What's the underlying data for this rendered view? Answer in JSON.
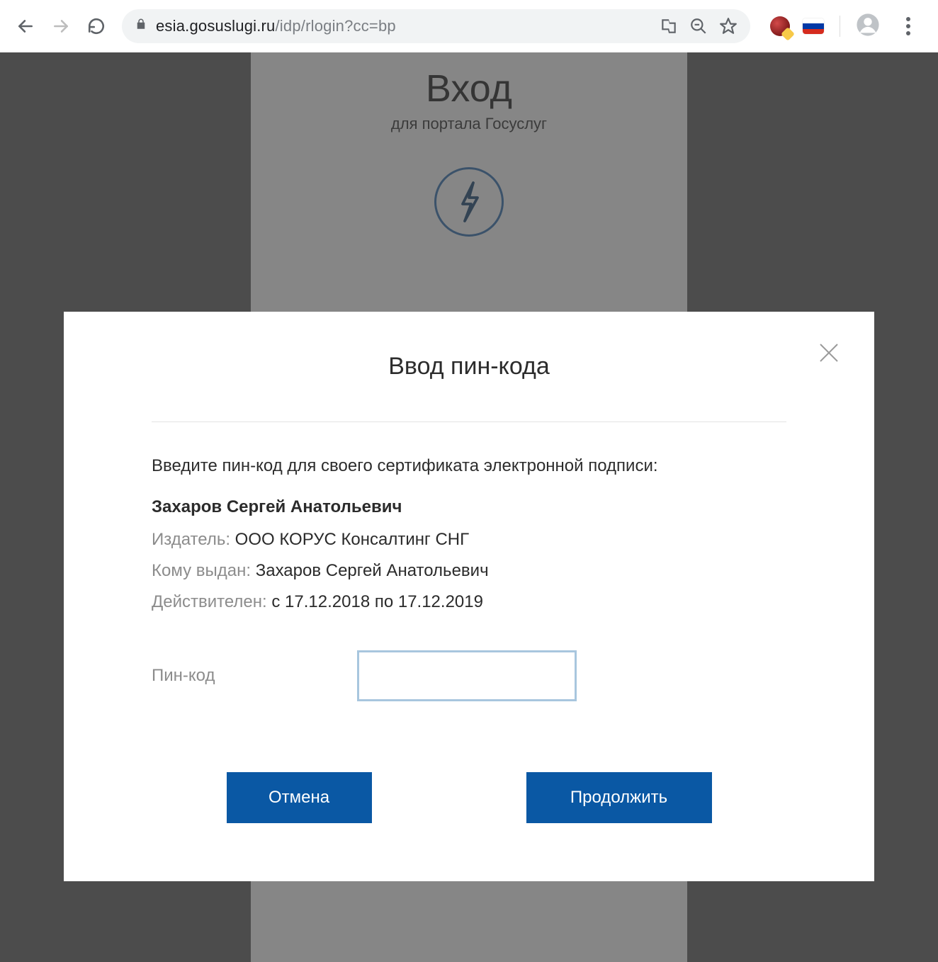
{
  "browser": {
    "url_host": "esia.gosuslugi.ru",
    "url_path": "/idp/rlogin?cc=bp"
  },
  "background_page": {
    "title": "Вход",
    "subtitle": "для портала Госуслуг"
  },
  "modal": {
    "title": "Ввод пин-кода",
    "instruction": "Введите пин-код для своего сертификата электронной подписи:",
    "cert_owner_name": "Захаров Сергей Анатольевич",
    "issuer_label": "Издатель:",
    "issuer_value": "ООО КОРУС Консалтинг СНГ",
    "subject_label": "Кому выдан:",
    "subject_value": "Захаров Сергей Анатольевич",
    "valid_label": "Действителен:",
    "valid_value": "с 17.12.2018 по 17.12.2019",
    "pin_label": "Пин-код",
    "pin_value": "",
    "cancel_label": "Отмена",
    "continue_label": "Продолжить"
  }
}
